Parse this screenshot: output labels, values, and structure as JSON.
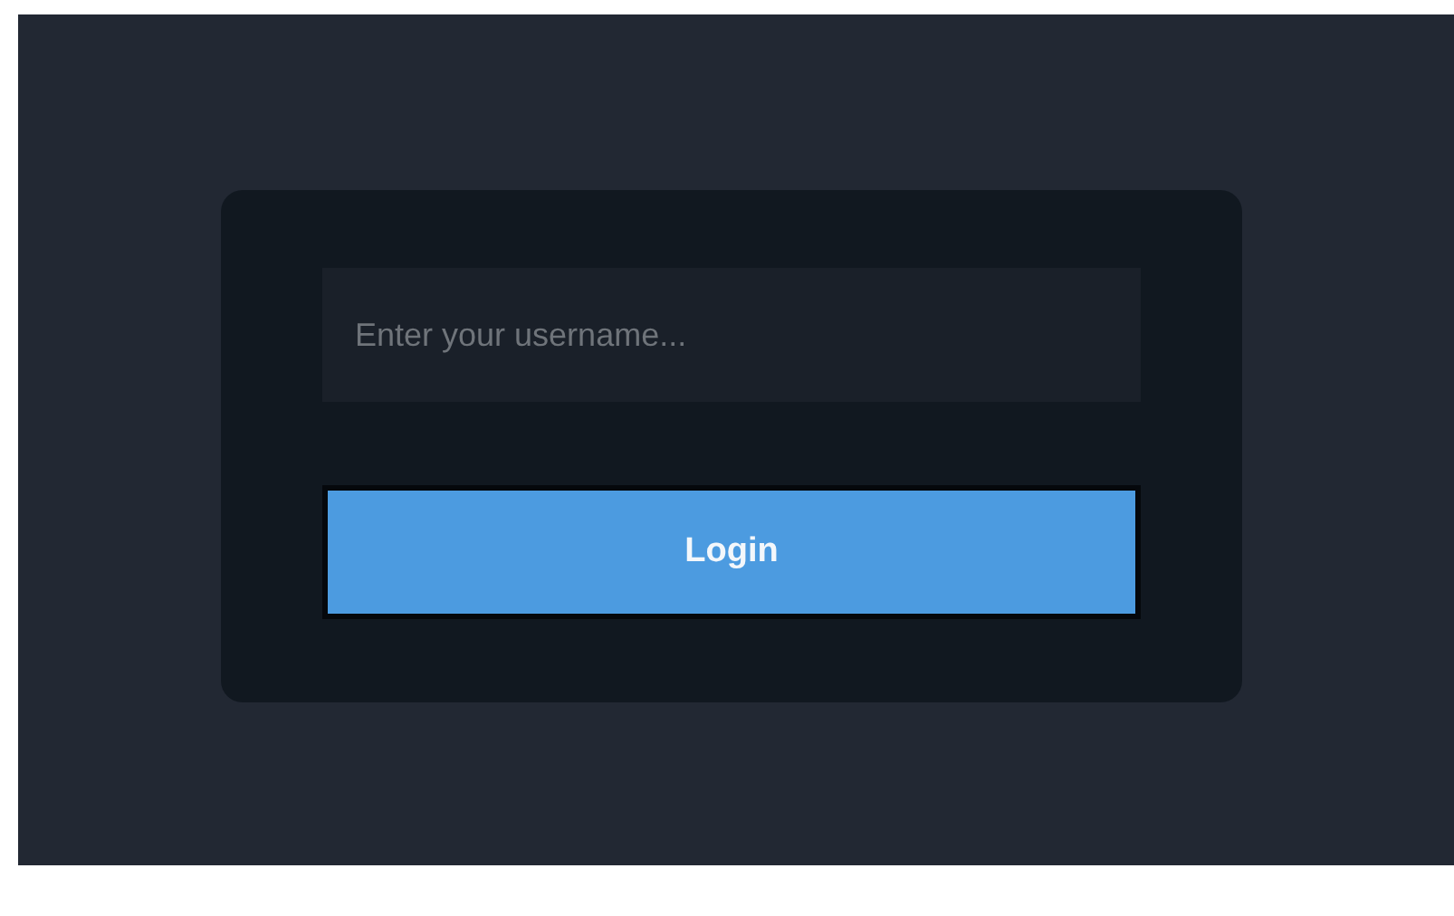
{
  "login_form": {
    "username": {
      "placeholder": "Enter your username..."
    },
    "button": "Login"
  }
}
